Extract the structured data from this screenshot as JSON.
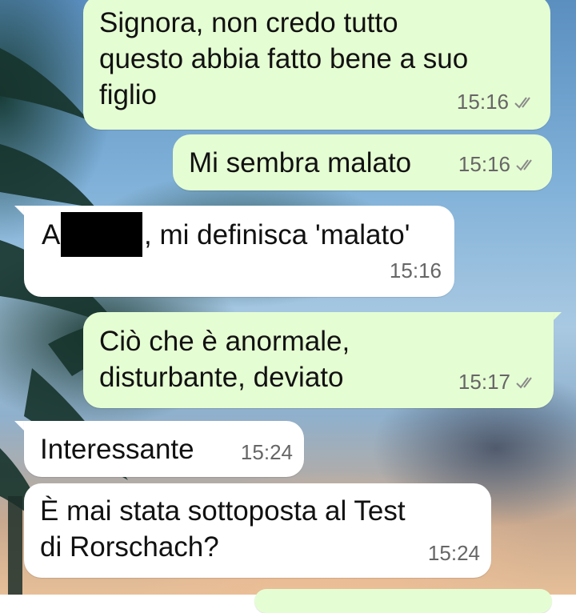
{
  "chat": {
    "messages": [
      {
        "direction": "outgoing",
        "text": "Signora, non credo tutto\nquesto abbia fatto bene a suo\nfiglio",
        "time": "15:16",
        "status": "read-ticks"
      },
      {
        "direction": "outgoing",
        "text": "Mi sembra malato",
        "time": "15:16",
        "status": "read-ticks"
      },
      {
        "direction": "incoming",
        "text_prefix": "A",
        "text_suffix": ", mi definisca 'malato'",
        "time": "15:16",
        "redacted": true
      },
      {
        "direction": "outgoing",
        "text": "Ciò che è anormale,\ndisturbante, deviato",
        "time": "15:17",
        "status": "read-ticks"
      },
      {
        "direction": "incoming",
        "text": "Interessante",
        "time": "15:24"
      },
      {
        "direction": "incoming",
        "text": "È mai stata sottoposta al Test\ndi Rorschach?",
        "time": "15:24"
      }
    ]
  },
  "colors": {
    "outgoing_bubble": "#e5fdd3",
    "incoming_bubble": "#ffffff",
    "timestamp": "#666666"
  },
  "icons": {
    "status": "double-check-icon"
  }
}
